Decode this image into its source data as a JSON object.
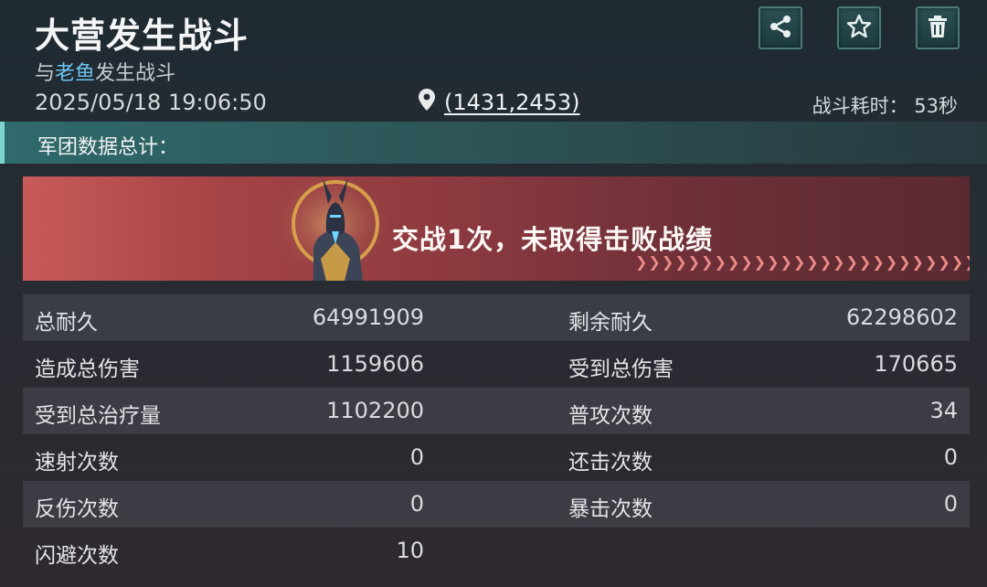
{
  "header": {
    "title": "大营发生战斗",
    "subtitle_prefix": "与",
    "subtitle_name": "老鱼",
    "subtitle_suffix": "发生战斗",
    "datetime": "2025/05/18  19:06:50",
    "coordinates": "(1431,2453)",
    "duration_label": "战斗耗时：",
    "duration_value": "53秒"
  },
  "actions": {
    "share_icon": "share-icon",
    "favorite_icon": "star-icon",
    "delete_icon": "trash-icon"
  },
  "section": {
    "title": "军团数据总计："
  },
  "banner": {
    "message": "交战1次，未取得击败战绩",
    "chevrons": "❯❯❯❯❯❯❯❯❯❯❯❯❯❯❯❯❯❯❯❯❯❯❯❯❯❯❯❯❯❯❯❯"
  },
  "stats": [
    {
      "l1": "总耐久",
      "v1": "64991909",
      "l2": "剩余耐久",
      "v2": "62298602"
    },
    {
      "l1": "造成总伤害",
      "v1": "1159606",
      "l2": "受到总伤害",
      "v2": "170665"
    },
    {
      "l1": "受到总治疗量",
      "v1": "1102200",
      "l2": "普攻次数",
      "v2": "34"
    },
    {
      "l1": "速射次数",
      "v1": "0",
      "l2": "还击次数",
      "v2": "0"
    },
    {
      "l1": "反伤次数",
      "v1": "0",
      "l2": "暴击次数",
      "v2": "0"
    },
    {
      "l1": "闪避次数",
      "v1": "10",
      "l2": "",
      "v2": ""
    }
  ],
  "colors": {
    "accent_teal": "#7fd3d0",
    "player_name": "#6ec4f0",
    "banner_red": "#a64446"
  }
}
